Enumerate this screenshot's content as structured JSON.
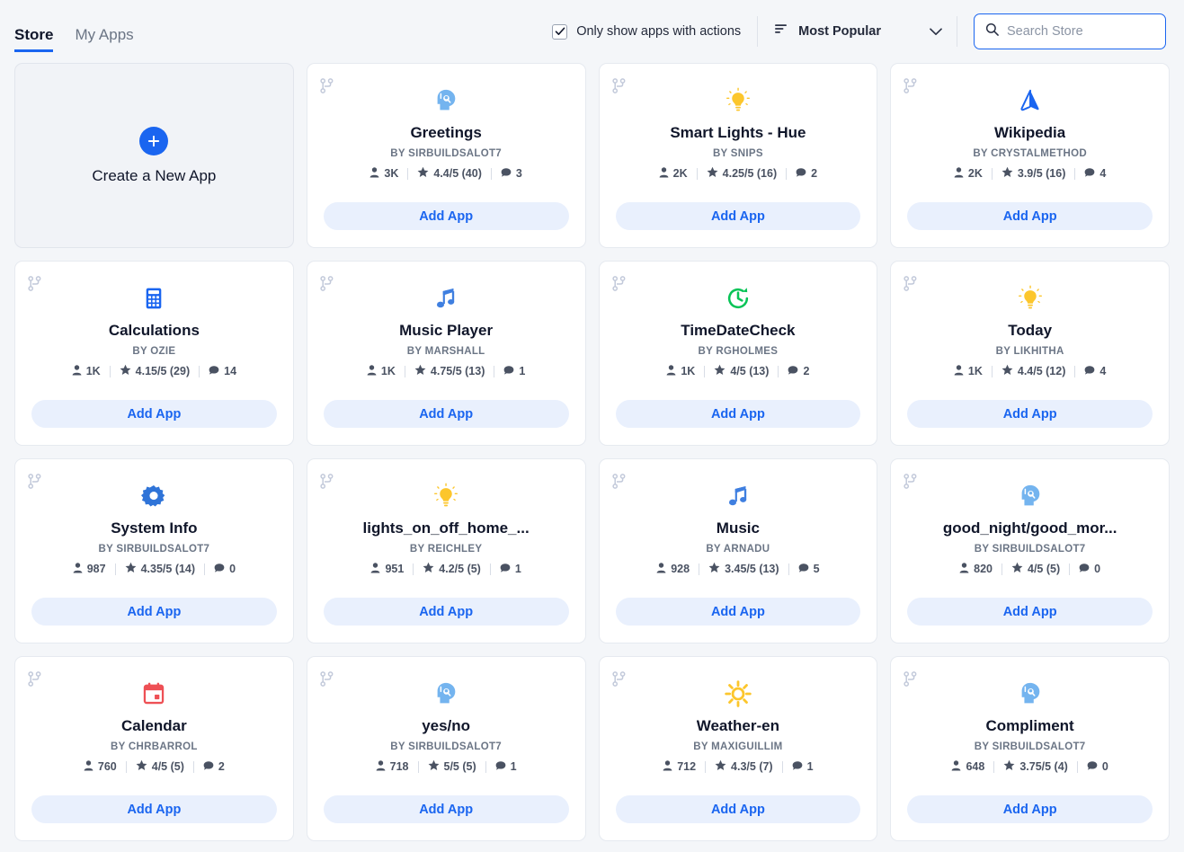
{
  "header": {
    "tabs": [
      {
        "label": "Store",
        "active": true
      },
      {
        "label": "My Apps",
        "active": false
      }
    ],
    "filter": {
      "label": "Only show apps with actions",
      "checked": true,
      "icon": "checkbox-checked-icon"
    },
    "sort": {
      "label": "Most Popular",
      "icon": "sort-icon",
      "chevron": "chevron-down-icon"
    },
    "search": {
      "placeholder": "Search Store",
      "value": "",
      "icon": "search-icon"
    }
  },
  "create_card": {
    "label": "Create a New App",
    "icon": "plus-icon"
  },
  "colors": {
    "accent": "#1a65f0",
    "add_btn_bg": "#e9f0fd",
    "page_bg": "#f4f6f9",
    "card_bg": "#ffffff",
    "icon_yellow": "#fcc62c",
    "icon_blue": "#1a65f0",
    "icon_lightblue": "#74b4ef",
    "icon_green": "#08c457",
    "icon_red": "#ee5055"
  },
  "labels": {
    "add_app": "Add App",
    "by_prefix": "BY ",
    "fork_icon": "fork-branch-icon",
    "users_icon": "person-icon",
    "rating_icon": "star-icon",
    "comments_icon": "comment-icon"
  },
  "apps": [
    {
      "name": "Greetings",
      "author": "SIRBUILDSALOT7",
      "users": "3K",
      "rating": "4.4/5 (40)",
      "comments": "3",
      "icon": "assistant-head-icon",
      "action": "Add App"
    },
    {
      "name": "Smart Lights - Hue",
      "author": "SNIPS",
      "users": "2K",
      "rating": "4.25/5 (16)",
      "comments": "2",
      "icon": "lightbulb-icon",
      "action": "Add App"
    },
    {
      "name": "Wikipedia",
      "author": "CRYSTALMETHOD",
      "users": "2K",
      "rating": "3.9/5 (16)",
      "comments": "4",
      "icon": "wikipedia-icon",
      "action": "Add App"
    },
    {
      "name": "Calculations",
      "author": "OZIE",
      "users": "1K",
      "rating": "4.15/5 (29)",
      "comments": "14",
      "icon": "calculator-icon",
      "action": "Add App"
    },
    {
      "name": "Music Player",
      "author": "MARSHALL",
      "users": "1K",
      "rating": "4.75/5 (13)",
      "comments": "1",
      "icon": "music-note-icon",
      "action": "Add App"
    },
    {
      "name": "TimeDateCheck",
      "author": "RGHOLMES",
      "users": "1K",
      "rating": "4/5 (13)",
      "comments": "2",
      "icon": "clock-refresh-icon",
      "action": "Add App"
    },
    {
      "name": "Today",
      "author": "LIKHITHA",
      "users": "1K",
      "rating": "4.4/5 (12)",
      "comments": "4",
      "icon": "lightbulb-icon",
      "action": "Add App"
    },
    {
      "name": "System Info",
      "author": "SIRBUILDSALOT7",
      "users": "987",
      "rating": "4.35/5 (14)",
      "comments": "0",
      "icon": "gear-icon",
      "action": "Add App"
    },
    {
      "name": "lights_on_off_home_...",
      "author": "REICHLEY",
      "users": "951",
      "rating": "4.2/5 (5)",
      "comments": "1",
      "icon": "lightbulb-icon",
      "action": "Add App"
    },
    {
      "name": "Music",
      "author": "ARNADU",
      "users": "928",
      "rating": "3.45/5 (13)",
      "comments": "5",
      "icon": "music-note-icon",
      "action": "Add App"
    },
    {
      "name": "good_night/good_mor...",
      "author": "SIRBUILDSALOT7",
      "users": "820",
      "rating": "4/5 (5)",
      "comments": "0",
      "icon": "assistant-head-icon",
      "action": "Add App"
    },
    {
      "name": "Calendar",
      "author": "CHRBARROL",
      "users": "760",
      "rating": "4/5 (5)",
      "comments": "2",
      "icon": "calendar-icon",
      "action": "Add App"
    },
    {
      "name": "yes/no",
      "author": "SIRBUILDSALOT7",
      "users": "718",
      "rating": "5/5 (5)",
      "comments": "1",
      "icon": "assistant-head-icon",
      "action": "Add App"
    },
    {
      "name": "Weather-en",
      "author": "MAXIGUILLIM",
      "users": "712",
      "rating": "4.3/5 (7)",
      "comments": "1",
      "icon": "sun-icon",
      "action": "Add App"
    },
    {
      "name": "Compliment",
      "author": "SIRBUILDSALOT7",
      "users": "648",
      "rating": "3.75/5 (4)",
      "comments": "0",
      "icon": "assistant-head-icon",
      "action": "Add App"
    }
  ]
}
